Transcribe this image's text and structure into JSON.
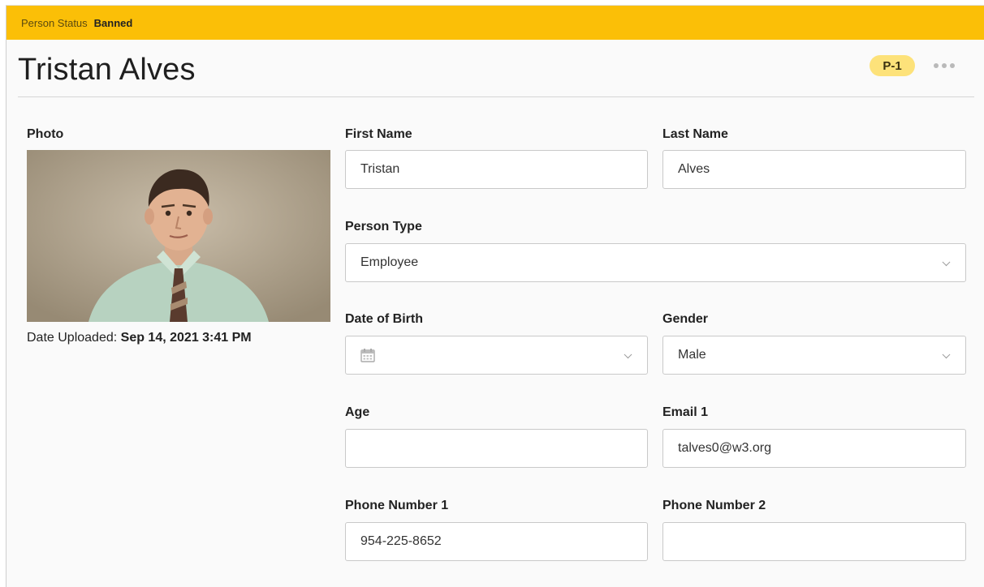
{
  "status": {
    "label": "Person Status",
    "value": "Banned"
  },
  "header": {
    "title": "Tristan Alves",
    "id_badge": "P-1",
    "more_icon": "ellipsis-icon"
  },
  "photo": {
    "label": "Photo",
    "uploaded_label": "Date Uploaded:",
    "uploaded_value": "Sep 14, 2021 3:41 PM"
  },
  "fields": {
    "first_name": {
      "label": "First Name",
      "value": "Tristan"
    },
    "last_name": {
      "label": "Last Name",
      "value": "Alves"
    },
    "person_type": {
      "label": "Person Type",
      "value": "Employee"
    },
    "date_of_birth": {
      "label": "Date of Birth",
      "value": ""
    },
    "gender": {
      "label": "Gender",
      "value": "Male"
    },
    "age": {
      "label": "Age",
      "value": ""
    },
    "email_1": {
      "label": "Email 1",
      "value": "talves0@w3.org"
    },
    "phone_1": {
      "label": "Phone Number 1",
      "value": "954-225-8652"
    },
    "phone_2": {
      "label": "Phone Number 2",
      "value": ""
    }
  },
  "colors": {
    "status_bar": "#fbbf07",
    "badge": "#fde27a"
  }
}
